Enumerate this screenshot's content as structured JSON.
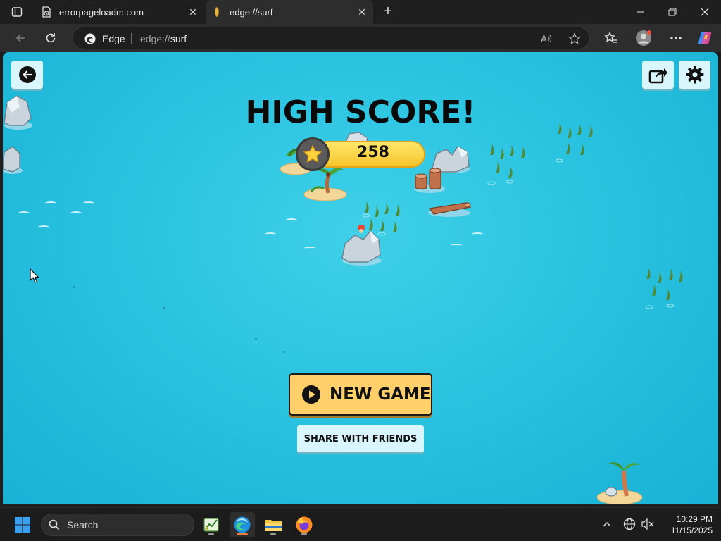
{
  "browser": {
    "tabs": [
      {
        "title": "errorpageloadm.com",
        "favicon": "error-page-icon",
        "active": false
      },
      {
        "title": "edge://surf",
        "favicon": "surf-icon",
        "active": true
      }
    ],
    "omnibox": {
      "edge_label": "Edge",
      "url_scheme": "edge://",
      "url_host": "surf"
    }
  },
  "game": {
    "title": "HIGH SCORE!",
    "score": "258",
    "new_game_label": "NEW GAME",
    "share_label": "SHARE WITH FRIENDS",
    "colors": {
      "ocean": "#2ac3e0",
      "button_yellow": "#ffcf6a",
      "score_gold": "#f6c52b",
      "light_button": "#d8f6fb"
    }
  },
  "taskbar": {
    "search_placeholder": "Search",
    "time": "10:29 PM",
    "date": "11/15/2025"
  }
}
